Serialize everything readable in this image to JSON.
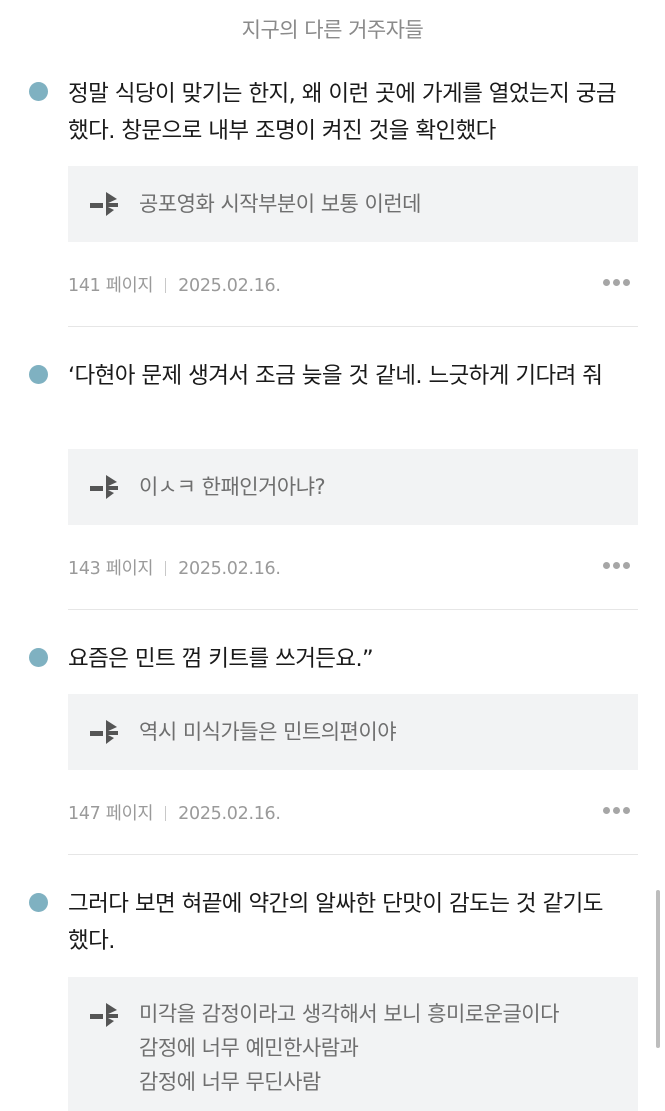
{
  "header": {
    "title": "지구의 다른 거주자들"
  },
  "entries": [
    {
      "quote": "정말 식당이 맞기는 한지, 왜 이런 곳에 가게를 열었는지 궁금했다. 창문으로 내부 조명이 켜진 것을 확인했다",
      "memo": [
        "공포영화 시작부분이 보통 이런데"
      ],
      "page": "141 페이지",
      "date": "2025.02.16."
    },
    {
      "quote": "‘다현아 문제 생겨서 조금 늦을 것 같네. 느긋하게 기다려 줘",
      "memo": [
        "이ㅅㅋ 한패인거아냐?"
      ],
      "page": "143 페이지",
      "date": "2025.02.16."
    },
    {
      "quote": "요즘은 민트 껌 키트를 쓰거든요.”",
      "memo": [
        "역시 미식가들은 민트의편이야"
      ],
      "page": "147 페이지",
      "date": "2025.02.16."
    },
    {
      "quote": "그러다 보면 혀끝에 약간의 알싸한 단맛이 감도는 것 같기도 했다.",
      "memo": [
        "미각을 감정이라고 생각해서 보니 흥미로운글이다",
        "감정에 너무 예민한사람과",
        "감정에 너무 무딘사람"
      ],
      "page": "",
      "date": ""
    }
  ],
  "icons": {
    "bullet": "dot-icon",
    "memo": "memo-icon",
    "more": "more-icon"
  },
  "colors": {
    "bullet": "#7fb1c1",
    "memo_bg": "#f2f3f4",
    "meta_text": "#9a9a9a"
  }
}
